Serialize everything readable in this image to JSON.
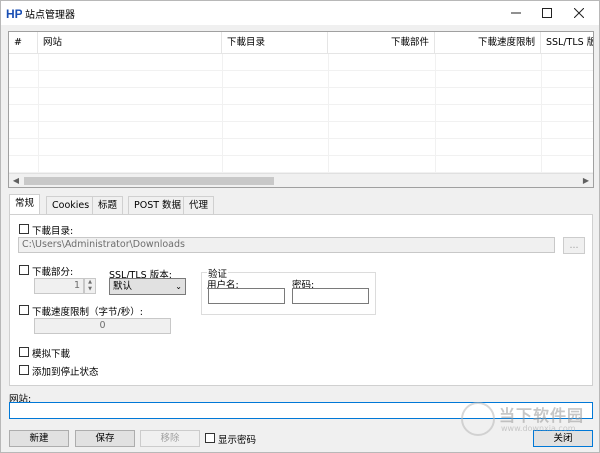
{
  "window": {
    "title": "站点管理器",
    "app_icon_glyph": "HP"
  },
  "table": {
    "columns": [
      "#",
      "网站",
      "下載目录",
      "下載部件",
      "下載速度限制",
      "SSL/TLS 版"
    ]
  },
  "tabs": [
    "常规",
    "Cookies",
    "标题",
    "POST 数据",
    "代理"
  ],
  "general": {
    "download_dir_label": "下載目录:",
    "download_dir_value": "C:\\Users\\Administrator\\Downloads",
    "browse_label": "...",
    "parts_label": "下載部分:",
    "parts_value": "1",
    "ssl_label": "SSL/TLS 版本:",
    "ssl_value": "默认",
    "auth_label": "验证",
    "username_label": "用户名:",
    "password_label": "密码:",
    "speed_label": "下載速度限制（字节/秒）:",
    "speed_value": "0",
    "simulate_label": "模拟下載",
    "add_stopped_label": "添加到停止状态"
  },
  "site": {
    "label": "网站:",
    "value": ""
  },
  "footer": {
    "new_label": "新建",
    "save_label": "保存",
    "remove_label": "移除",
    "show_password_label": "显示密码",
    "close_label": "关闭"
  },
  "watermark": {
    "text": "当下软件园",
    "url": "www.downxia.com"
  },
  "colors": {
    "accent": "#0078d7",
    "app_icon": "#1a4fb4"
  }
}
